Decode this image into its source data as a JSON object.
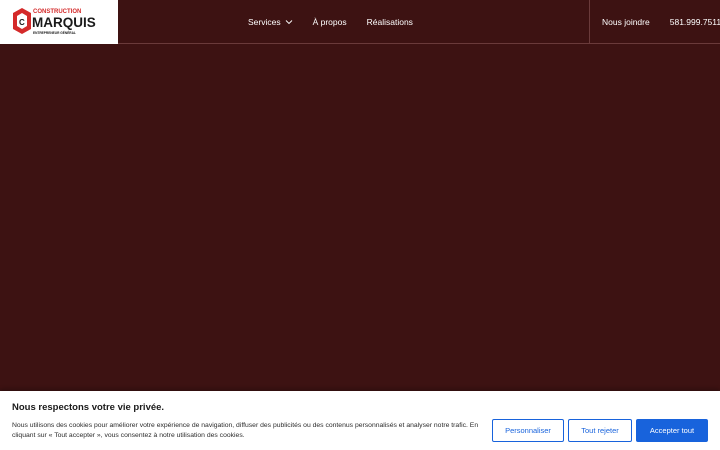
{
  "brand": {
    "name_top": "CONSTRUCTION",
    "name_main": "MARQUIS",
    "tagline": "ENTREPRENEUR GÉNÉRAL",
    "colors": {
      "red": "#d42a2a",
      "dark": "#1a1a1a"
    }
  },
  "nav": {
    "items": [
      {
        "label": "Services",
        "icon": "chevron-down-icon"
      },
      {
        "label": "À propos"
      },
      {
        "label": "Réalisations"
      }
    ],
    "contact_label": "Nous joindre",
    "phone": "581.999.7511"
  },
  "theme": {
    "background": "#3d1212",
    "accent": "#1863dc"
  },
  "cookie": {
    "title": "Nous respectons votre vie privée.",
    "text": "Nous utilisons des cookies pour améliorer votre expérience de navigation, diffuser des publicités ou des contenus personnalisés et analyser notre trafic. En cliquant sur « Tout accepter », vous consentez à notre utilisation des cookies.",
    "buttons": {
      "customize": "Personnaliser",
      "reject": "Tout rejeter",
      "accept": "Accepter tout"
    }
  }
}
